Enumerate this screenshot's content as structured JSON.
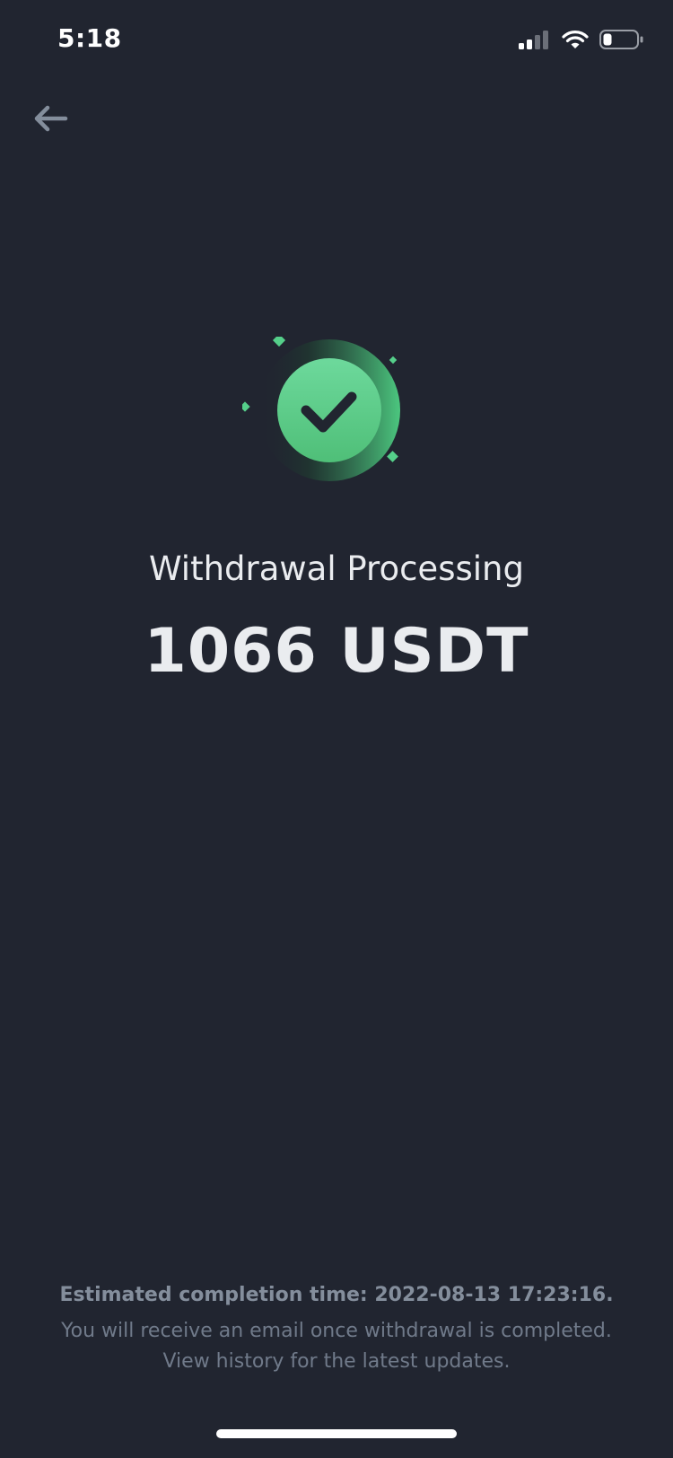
{
  "status_bar": {
    "time": "5:18",
    "signal_icon": "cellular-signal-icon",
    "wifi_icon": "wifi-icon",
    "battery_icon": "battery-icon"
  },
  "nav": {
    "back_icon": "arrow-left-icon"
  },
  "hero": {
    "icon": "success-check-icon",
    "accent_color": "#5fcf8d"
  },
  "result": {
    "title": "Withdrawal Processing",
    "amount": "1066 USDT"
  },
  "footer": {
    "estimated_completion": "Estimated completion time: 2022-08-13 17:23:16.",
    "note_line1": "You will receive an email once withdrawal is completed.",
    "note_line2": "View history for the latest updates."
  }
}
